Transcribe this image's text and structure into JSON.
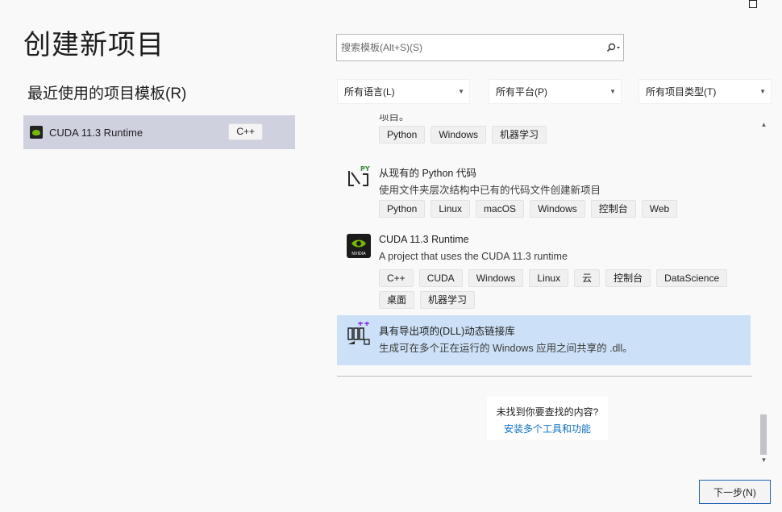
{
  "title": "创建新项目",
  "recent": {
    "heading": "最近使用的项目模板(R)",
    "items": [
      {
        "label": "CUDA 11.3 Runtime",
        "tag": "C++",
        "icon": "nvidia-icon"
      }
    ]
  },
  "search": {
    "placeholder": "搜索模板(Alt+S)(S)",
    "icon": "search-icon"
  },
  "filters": {
    "language": "所有语言(L)",
    "platform": "所有平台(P)",
    "project_type": "所有项目类型(T)"
  },
  "templates": [
    {
      "name": "",
      "desc": "项目。",
      "tags": [
        "Python",
        "Windows",
        "机器学习"
      ]
    },
    {
      "name": "从现有的 Python 代码",
      "desc": "使用文件夹层次结构中已有的代码文件创建新项目",
      "icon": "python-from-code-icon",
      "tags": [
        "Python",
        "Linux",
        "macOS",
        "Windows",
        "控制台",
        "Web"
      ]
    },
    {
      "name": "CUDA 11.3 Runtime",
      "desc": "A project that uses the CUDA 11.3 runtime",
      "icon": "nvidia-icon",
      "tags": [
        "C++",
        "CUDA",
        "Windows",
        "Linux",
        "云",
        "控制台",
        "DataScience",
        "桌面",
        "机器学习"
      ]
    },
    {
      "name": "具有导出项的(DLL)动态链接库",
      "desc": "生成可在多个正在运行的 Windows 应用之间共享的 .dll。",
      "icon": "dll-icon",
      "selected": true
    }
  ],
  "not_found": {
    "question": "未找到你要查找的内容?",
    "link": "安装多个工具和功能"
  },
  "buttons": {
    "next": "下一步(N)"
  },
  "colors": {
    "selected": "#cce0f7",
    "recent_selected": "#cfd1df",
    "link": "#0e70c0",
    "accent_border": "#1e62b4"
  }
}
